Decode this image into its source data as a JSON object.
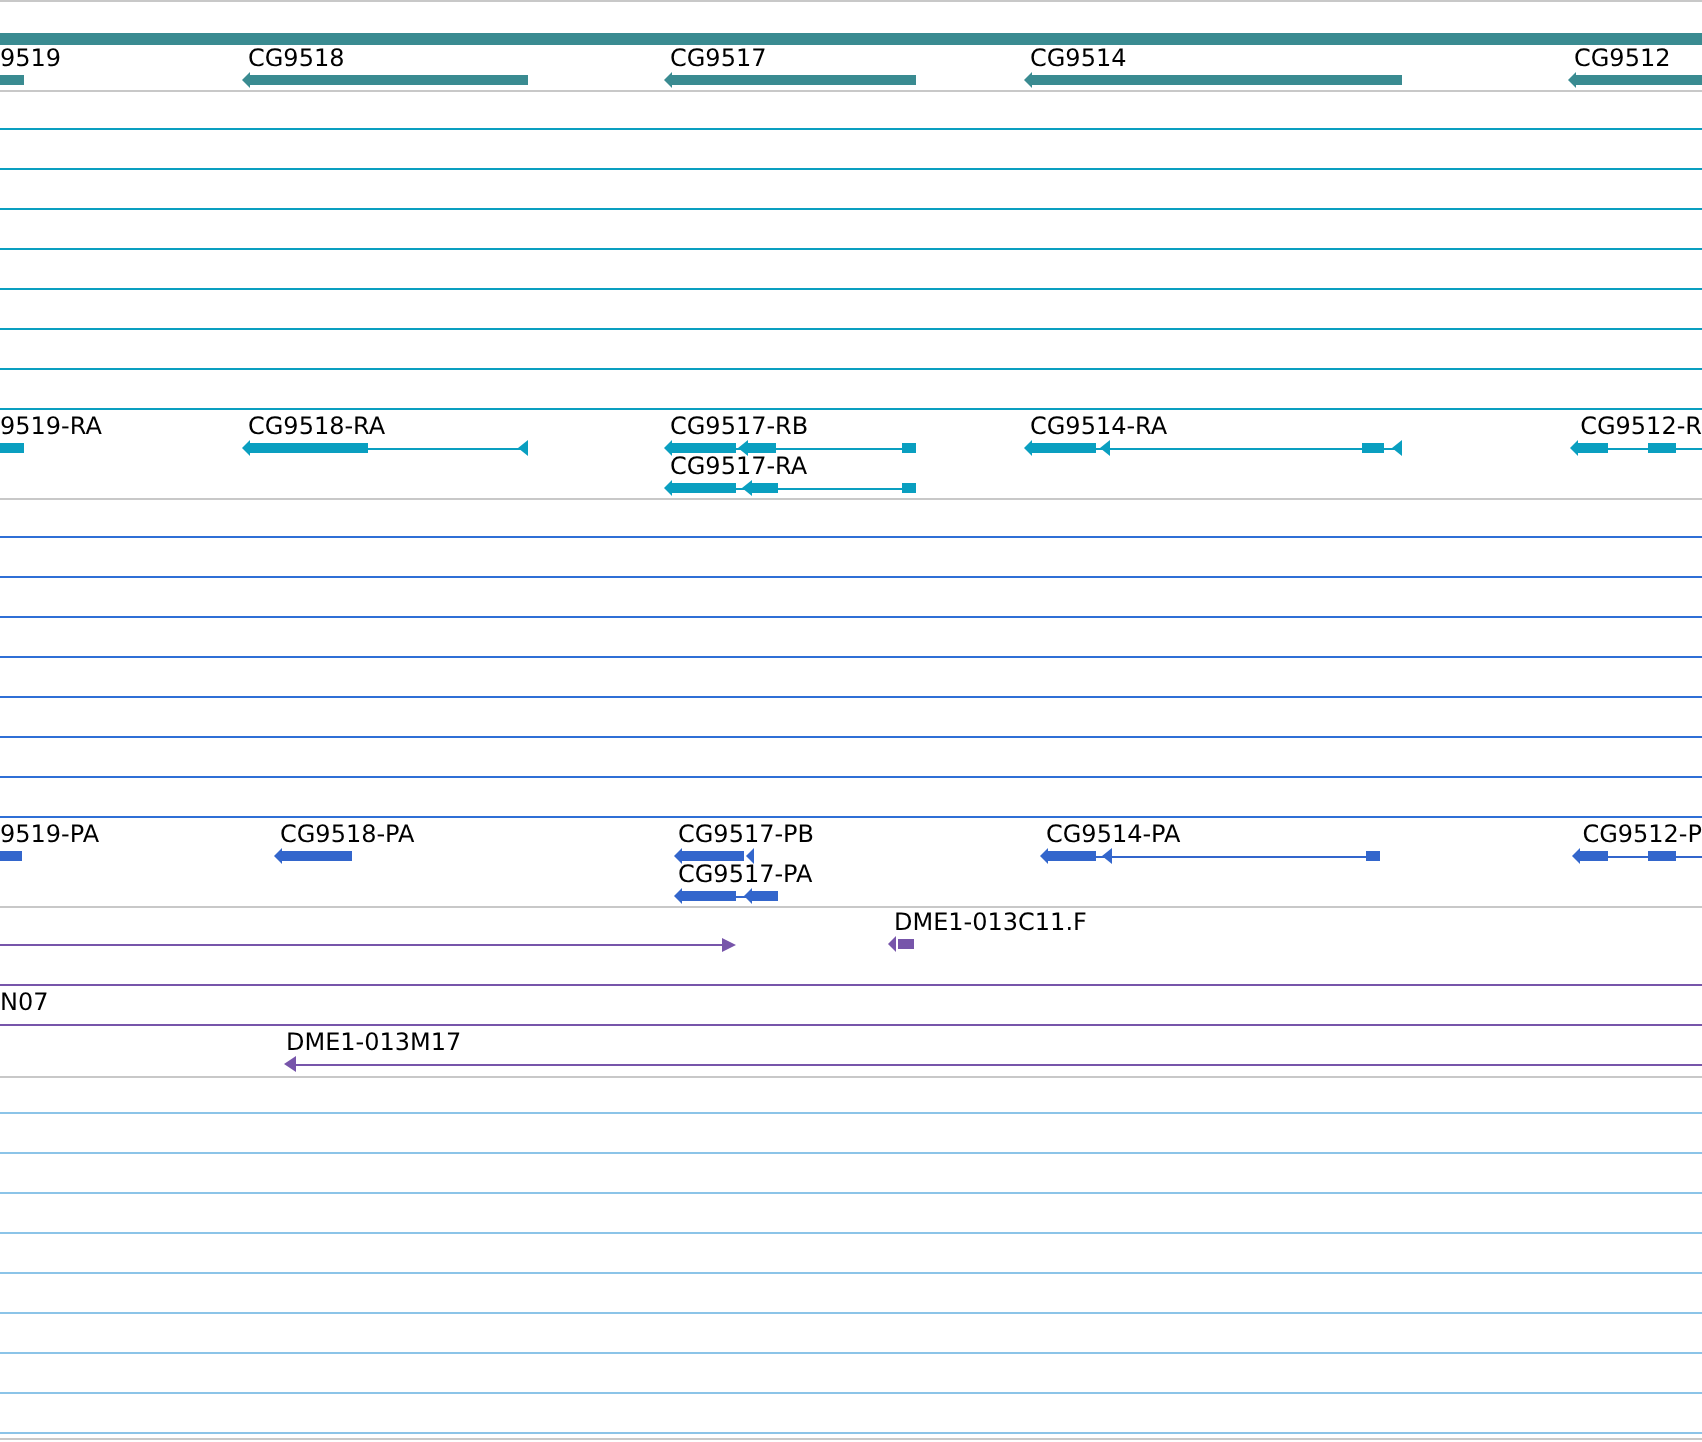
{
  "tracks": [
    {
      "kind": "gene",
      "features": [
        {
          "label": "9519"
        },
        {
          "label": "CG9518"
        },
        {
          "label": "CG9517"
        },
        {
          "label": "CG9514"
        },
        {
          "label": "CG9512"
        }
      ]
    },
    {
      "kind": "transcript",
      "features": [
        {
          "label": "9519-RA"
        },
        {
          "label": "CG9518-RA"
        },
        {
          "label": "CG9517-RB"
        },
        {
          "label": "CG9517-RA"
        },
        {
          "label": "CG9514-RA"
        },
        {
          "label": "CG9512-R"
        }
      ]
    },
    {
      "kind": "protein",
      "features": [
        {
          "label": "9519-PA"
        },
        {
          "label": "CG9518-PA"
        },
        {
          "label": "CG9517-PB"
        },
        {
          "label": "CG9517-PA"
        },
        {
          "label": "CG9514-PA"
        },
        {
          "label": "CG9512-P"
        }
      ]
    },
    {
      "kind": "clone",
      "features": [
        {
          "label": "DME1-013C11.F"
        },
        {
          "label": "N07"
        },
        {
          "label": "DME1-013M17"
        }
      ]
    }
  ]
}
